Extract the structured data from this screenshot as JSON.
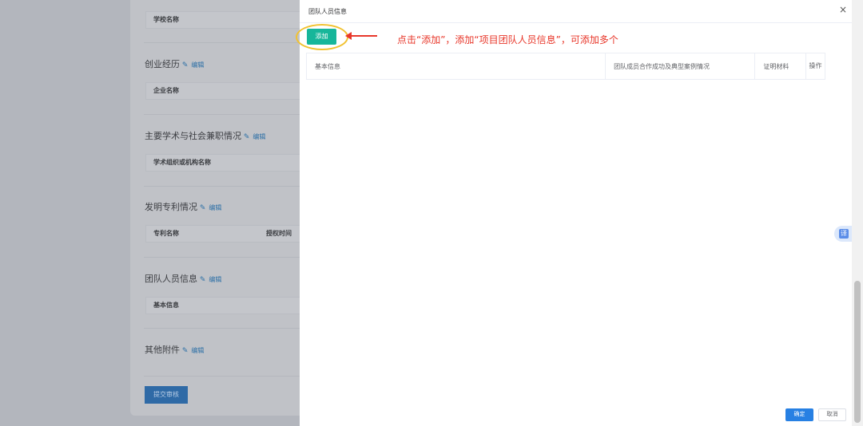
{
  "background": {
    "rows": {
      "school": "学校名称",
      "enterprise": "企业名称",
      "academic_org": "学术组织或机构名称",
      "patent_name": "专利名称",
      "patent_time": "授权时间",
      "basic_info": "基本信息"
    },
    "sections": {
      "startup": "创业经历",
      "academic": "主要学术与社会兼职情况",
      "patent": "发明专利情况",
      "team": "团队人员信息",
      "attachments": "其他附件"
    },
    "edit_label": "编辑",
    "submit_label": "提交审核"
  },
  "drawer": {
    "title": "团队人员信息",
    "close": "×",
    "add_label": "添加",
    "annotation": "点击“添加”，添加“项目团队人员信息”，可添加多个",
    "columns": [
      "基本信息",
      "团队成员合作成功及典型案例情况",
      "证明材料",
      "操作"
    ],
    "confirm_label": "确定",
    "cancel_label": "取消"
  },
  "side_tool": {
    "icon": "translate-icon",
    "glyph": "译"
  },
  "colors": {
    "accent_green": "#17b69a",
    "primary_blue": "#2780e3",
    "annotation_red": "#e8372a",
    "highlight_yellow": "#f1c232"
  }
}
